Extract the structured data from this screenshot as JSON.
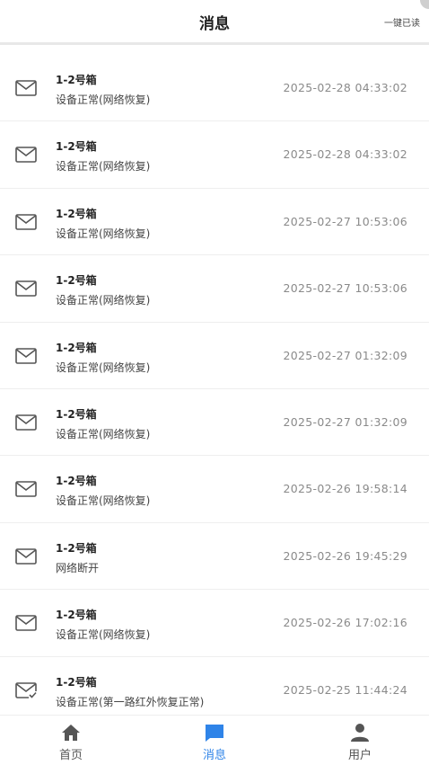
{
  "header": {
    "title": "消息",
    "mark_all_read": "一键已读"
  },
  "messages": [
    {
      "name": "1-2号箱",
      "desc": "设备正常(网络恢复)",
      "time": "2025-02-28 04:33:02",
      "icon": "mail-icon"
    },
    {
      "name": "1-2号箱",
      "desc": "设备正常(网络恢复)",
      "time": "2025-02-28 04:33:02",
      "icon": "mail-icon"
    },
    {
      "name": "1-2号箱",
      "desc": "设备正常(网络恢复)",
      "time": "2025-02-27 10:53:06",
      "icon": "mail-icon"
    },
    {
      "name": "1-2号箱",
      "desc": "设备正常(网络恢复)",
      "time": "2025-02-27 10:53:06",
      "icon": "mail-icon"
    },
    {
      "name": "1-2号箱",
      "desc": "设备正常(网络恢复)",
      "time": "2025-02-27 01:32:09",
      "icon": "mail-icon"
    },
    {
      "name": "1-2号箱",
      "desc": "设备正常(网络恢复)",
      "time": "2025-02-27 01:32:09",
      "icon": "mail-icon"
    },
    {
      "name": "1-2号箱",
      "desc": "设备正常(网络恢复)",
      "time": "2025-02-26 19:58:14",
      "icon": "mail-icon"
    },
    {
      "name": "1-2号箱",
      "desc": "网络断开",
      "time": "2025-02-26 19:45:29",
      "icon": "mail-icon"
    },
    {
      "name": "1-2号箱",
      "desc": "设备正常(网络恢复)",
      "time": "2025-02-26 17:02:16",
      "icon": "mail-icon"
    },
    {
      "name": "1-2号箱",
      "desc": "设备正常(第一路红外恢复正常)",
      "time": "2025-02-25 11:44:24",
      "icon": "mail-read-icon"
    }
  ],
  "tabbar": {
    "tabs": [
      {
        "label": "首页",
        "icon": "home-icon",
        "active": false
      },
      {
        "label": "消息",
        "icon": "message-icon",
        "active": true
      },
      {
        "label": "用户",
        "icon": "user-icon",
        "active": false
      }
    ],
    "active_color": "#2f84e8",
    "inactive_color": "#555555"
  }
}
